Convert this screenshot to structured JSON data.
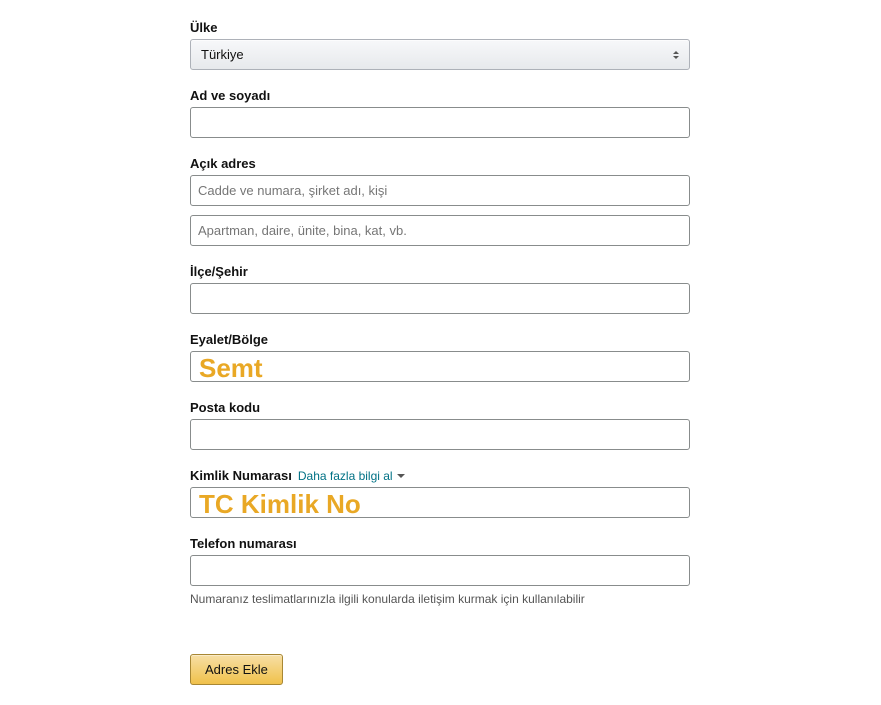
{
  "form": {
    "country": {
      "label": "Ülke",
      "value": "Türkiye"
    },
    "name": {
      "label": "Ad ve soyadı",
      "value": ""
    },
    "address": {
      "label": "Açık adres",
      "line1_placeholder": "Cadde ve numara, şirket adı, kişi",
      "line2_placeholder": "Apartman, daire, ünite, bina, kat, vb.",
      "line1_value": "",
      "line2_value": ""
    },
    "city": {
      "label": "İlçe/Şehir",
      "value": ""
    },
    "state": {
      "label": "Eyalet/Bölge",
      "annotation": "Semt",
      "value": ""
    },
    "postal": {
      "label": "Posta kodu",
      "value": ""
    },
    "idnum": {
      "label": "Kimlik Numarası",
      "info_link": "Daha fazla bilgi al",
      "annotation": "TC Kimlik No",
      "value": ""
    },
    "phone": {
      "label": "Telefon numarası",
      "value": "",
      "hint": "Numaranız teslimatlarınızla ilgili konularda iletişim kurmak için kullanılabilir"
    },
    "submit_label": "Adres Ekle"
  }
}
